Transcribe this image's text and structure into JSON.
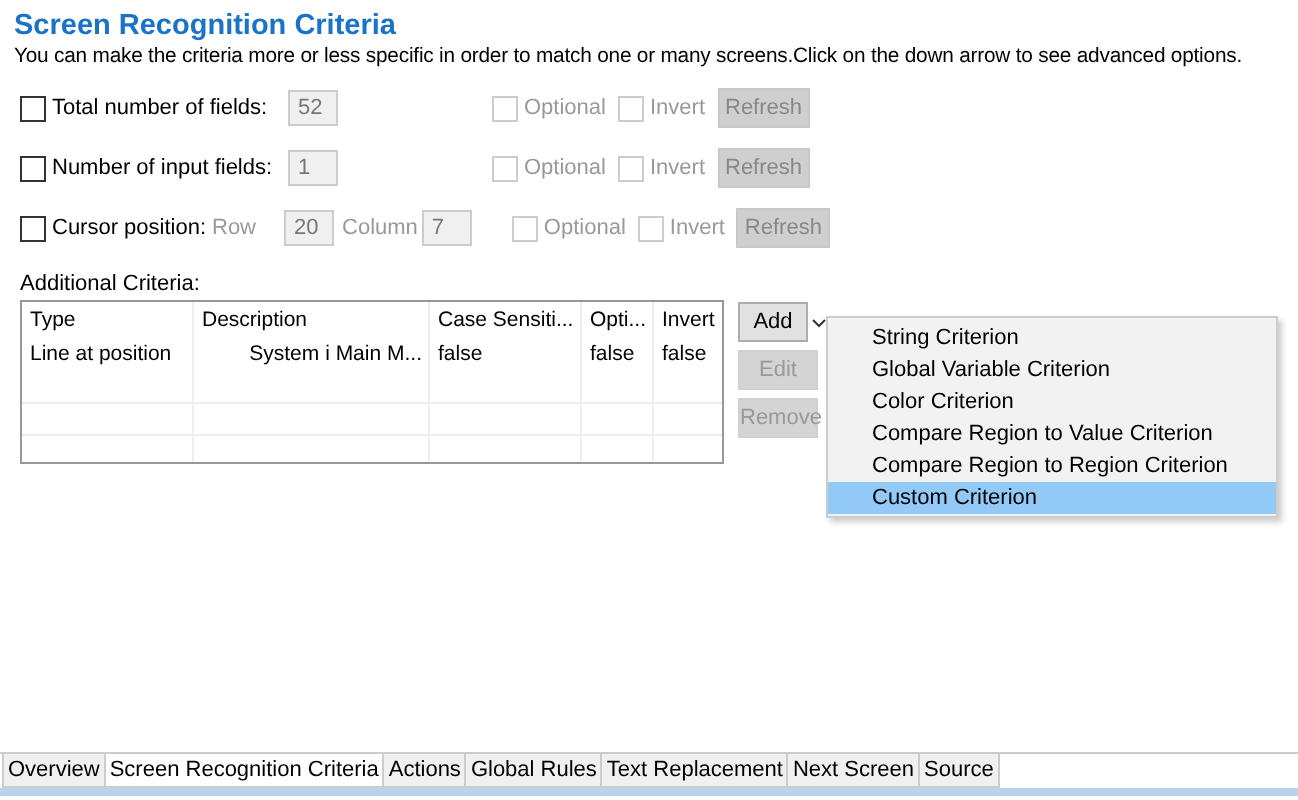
{
  "title": "Screen Recognition Criteria",
  "description": "You can make the criteria more or less specific in order to match one or many screens.Click on the down arrow to see advanced options.",
  "criteria": [
    {
      "kind": "single",
      "checked": false,
      "label": "Total number of fields:",
      "value": "52",
      "optional": {
        "label": "Optional",
        "checked": false
      },
      "invert": {
        "label": "Invert",
        "checked": false
      },
      "refresh": "Refresh"
    },
    {
      "kind": "single",
      "checked": false,
      "label": "Number of input fields:",
      "value": "1",
      "optional": {
        "label": "Optional",
        "checked": false
      },
      "invert": {
        "label": "Invert",
        "checked": false
      },
      "refresh": "Refresh"
    },
    {
      "kind": "cursor",
      "checked": false,
      "label": "Cursor position:",
      "row_label": "Row",
      "row_value": "20",
      "column_label": "Column",
      "column_value": "7",
      "optional": {
        "label": "Optional",
        "checked": false
      },
      "invert": {
        "label": "Invert",
        "checked": false
      },
      "refresh": "Refresh"
    }
  ],
  "additional_label": "Additional Criteria:",
  "table": {
    "columns": [
      "Type",
      "Description",
      "Case Sensiti...",
      "Opti...",
      "Invert"
    ],
    "rows": [
      [
        "Line at position",
        "System i Main M...",
        "false",
        "false",
        "false"
      ]
    ]
  },
  "buttons": [
    {
      "label": "Add",
      "disabled": false,
      "dropdown": true
    },
    {
      "label": "Edit",
      "disabled": true,
      "dropdown": false
    },
    {
      "label": "Remove",
      "disabled": true,
      "dropdown": false
    }
  ],
  "menu": [
    {
      "label": "String Criterion",
      "selected": false
    },
    {
      "label": "Global Variable Criterion",
      "selected": false
    },
    {
      "label": "Color Criterion",
      "selected": false
    },
    {
      "label": "Compare Region to Value Criterion",
      "selected": false
    },
    {
      "label": "Compare Region to Region Criterion",
      "selected": false
    },
    {
      "label": "Custom Criterion",
      "selected": true
    }
  ],
  "tabs": [
    {
      "label": "Overview",
      "selected": false
    },
    {
      "label": "Screen Recognition Criteria",
      "selected": true
    },
    {
      "label": "Actions",
      "selected": false
    },
    {
      "label": "Global Rules",
      "selected": false
    },
    {
      "label": "Text Replacement",
      "selected": false
    },
    {
      "label": "Next Screen",
      "selected": false
    },
    {
      "label": "Source",
      "selected": false
    }
  ]
}
